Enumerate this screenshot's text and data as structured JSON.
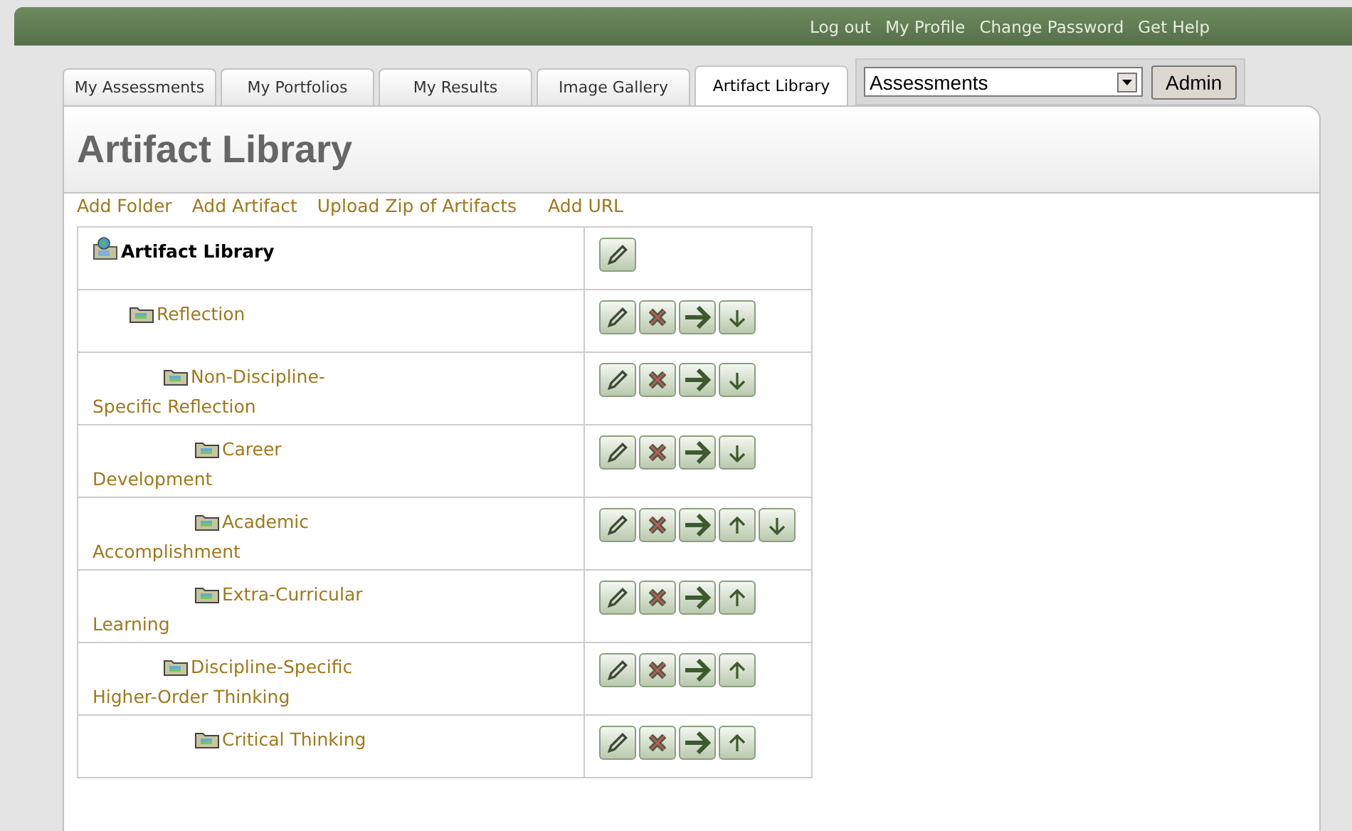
{
  "top_links": [
    "Log out",
    "My Profile",
    "Change Password",
    "Get Help"
  ],
  "tabs": [
    {
      "label": "My Assessments",
      "selected": false
    },
    {
      "label": "My Portfolios",
      "selected": false
    },
    {
      "label": "My Results",
      "selected": false
    },
    {
      "label": "Image Gallery",
      "selected": false
    },
    {
      "label": "Artifact Library",
      "selected": true
    }
  ],
  "selector": {
    "value": "Assessments",
    "button": "Admin"
  },
  "page_title": "Artifact Library",
  "actions": [
    "Add Folder",
    "Add Artifact",
    "Upload Zip of Artifacts",
    "Add URL"
  ],
  "tree": {
    "name": "Artifact Library",
    "kind": "library",
    "actions": [
      {
        "kind": "edit"
      }
    ],
    "children": [
      {
        "name": "Reflection",
        "kind": "folder",
        "actions": [
          {
            "kind": "edit"
          },
          {
            "kind": "delete"
          },
          {
            "kind": "move"
          },
          {
            "kind": "down"
          }
        ],
        "children": [
          {
            "name": "Non-Discipline-Specific Reflection",
            "kind": "folder",
            "actions": [
              {
                "kind": "edit"
              },
              {
                "kind": "delete"
              },
              {
                "kind": "move"
              },
              {
                "kind": "down"
              }
            ],
            "children": [
              {
                "name": "Career Development",
                "kind": "folder",
                "actions": [
                  {
                    "kind": "edit"
                  },
                  {
                    "kind": "delete"
                  },
                  {
                    "kind": "move"
                  },
                  {
                    "kind": "down"
                  }
                ]
              },
              {
                "name": "Academic Accomplishment",
                "kind": "folder",
                "actions": [
                  {
                    "kind": "edit"
                  },
                  {
                    "kind": "delete"
                  },
                  {
                    "kind": "move"
                  },
                  {
                    "kind": "up"
                  },
                  {
                    "kind": "down"
                  }
                ]
              },
              {
                "name": "Extra-Curricular Learning",
                "kind": "folder",
                "actions": [
                  {
                    "kind": "edit"
                  },
                  {
                    "kind": "delete"
                  },
                  {
                    "kind": "move"
                  },
                  {
                    "kind": "up"
                  }
                ]
              }
            ]
          },
          {
            "name": "Discipline-Specific Higher-Order Thinking",
            "kind": "folder",
            "actions": [
              {
                "kind": "edit"
              },
              {
                "kind": "delete"
              },
              {
                "kind": "move"
              },
              {
                "kind": "up"
              }
            ],
            "children": [
              {
                "name": "Critical Thinking",
                "kind": "folder",
                "actions": [
                  {
                    "kind": "edit"
                  },
                  {
                    "kind": "delete"
                  },
                  {
                    "kind": "move"
                  },
                  {
                    "kind": "up"
                  }
                ]
              }
            ]
          }
        ]
      }
    ]
  }
}
